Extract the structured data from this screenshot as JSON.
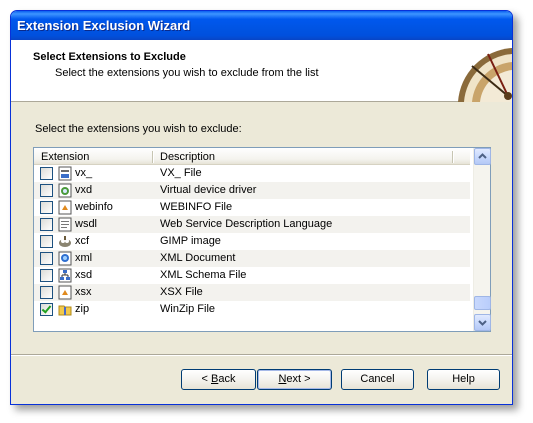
{
  "window": {
    "title": "Extension Exclusion Wizard"
  },
  "header": {
    "title": "Select Extensions to Exclude",
    "subtitle": "Select the extensions you wish to exclude from the list"
  },
  "main": {
    "prompt": "Select the extensions you wish to exclude:",
    "columns": [
      "Extension",
      "Description"
    ],
    "rows": [
      {
        "ext": "vx_",
        "desc": "VX_ File",
        "checked": false,
        "icon": "generic-file-icon"
      },
      {
        "ext": "vxd",
        "desc": "Virtual device driver",
        "checked": false,
        "icon": "driver-file-icon"
      },
      {
        "ext": "webinfo",
        "desc": "WEBINFO File",
        "checked": false,
        "icon": "webinfo-file-icon"
      },
      {
        "ext": "wsdl",
        "desc": "Web Service Description Language",
        "checked": false,
        "icon": "wsdl-file-icon"
      },
      {
        "ext": "xcf",
        "desc": "GIMP image",
        "checked": false,
        "icon": "gimp-image-icon"
      },
      {
        "ext": "xml",
        "desc": "XML Document",
        "checked": false,
        "icon": "xml-document-icon"
      },
      {
        "ext": "xsd",
        "desc": "XML Schema File",
        "checked": false,
        "icon": "xml-schema-icon"
      },
      {
        "ext": "xsx",
        "desc": "XSX File",
        "checked": false,
        "icon": "xsx-file-icon"
      },
      {
        "ext": "zip",
        "desc": "WinZip File",
        "checked": true,
        "icon": "zip-folder-icon"
      }
    ]
  },
  "buttons": {
    "back_prefix": "< ",
    "back_key": "B",
    "back_rest": "ack",
    "next_key": "N",
    "next_rest": "ext >",
    "cancel": "Cancel",
    "help": "Help"
  },
  "colors": {
    "titlebar": "#0054e3",
    "dialog_face": "#ece9d8",
    "checkbox_tick": "#21a121"
  }
}
